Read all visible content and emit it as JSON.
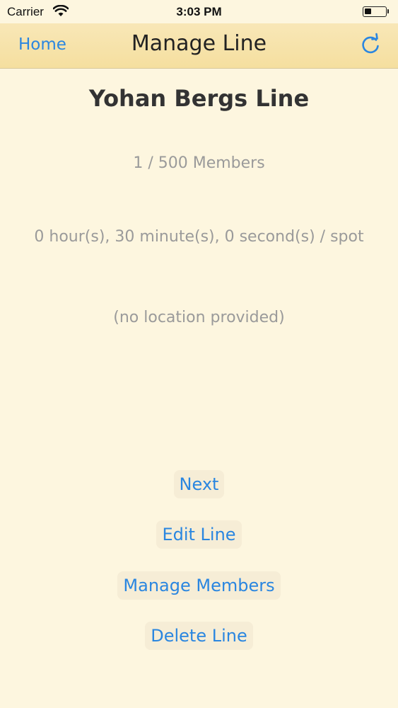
{
  "status_bar": {
    "carrier": "Carrier",
    "time": "3:03 PM"
  },
  "nav": {
    "back_label": "Home",
    "title": "Manage Line",
    "refresh_icon": "refresh-icon"
  },
  "line": {
    "name": "Yohan Bergs Line",
    "members": "1 / 500 Members",
    "duration": "0 hour(s), 30 minute(s), 0 second(s) / spot",
    "location": "(no location provided)"
  },
  "actions": {
    "next": "Next",
    "edit": "Edit Line",
    "manage_members": "Manage Members",
    "delete": "Delete Line"
  },
  "colors": {
    "background": "#fdf6df",
    "nav_background": "#f6e2a8",
    "accent": "#2a86e0",
    "muted_text": "#9a9a9a"
  }
}
